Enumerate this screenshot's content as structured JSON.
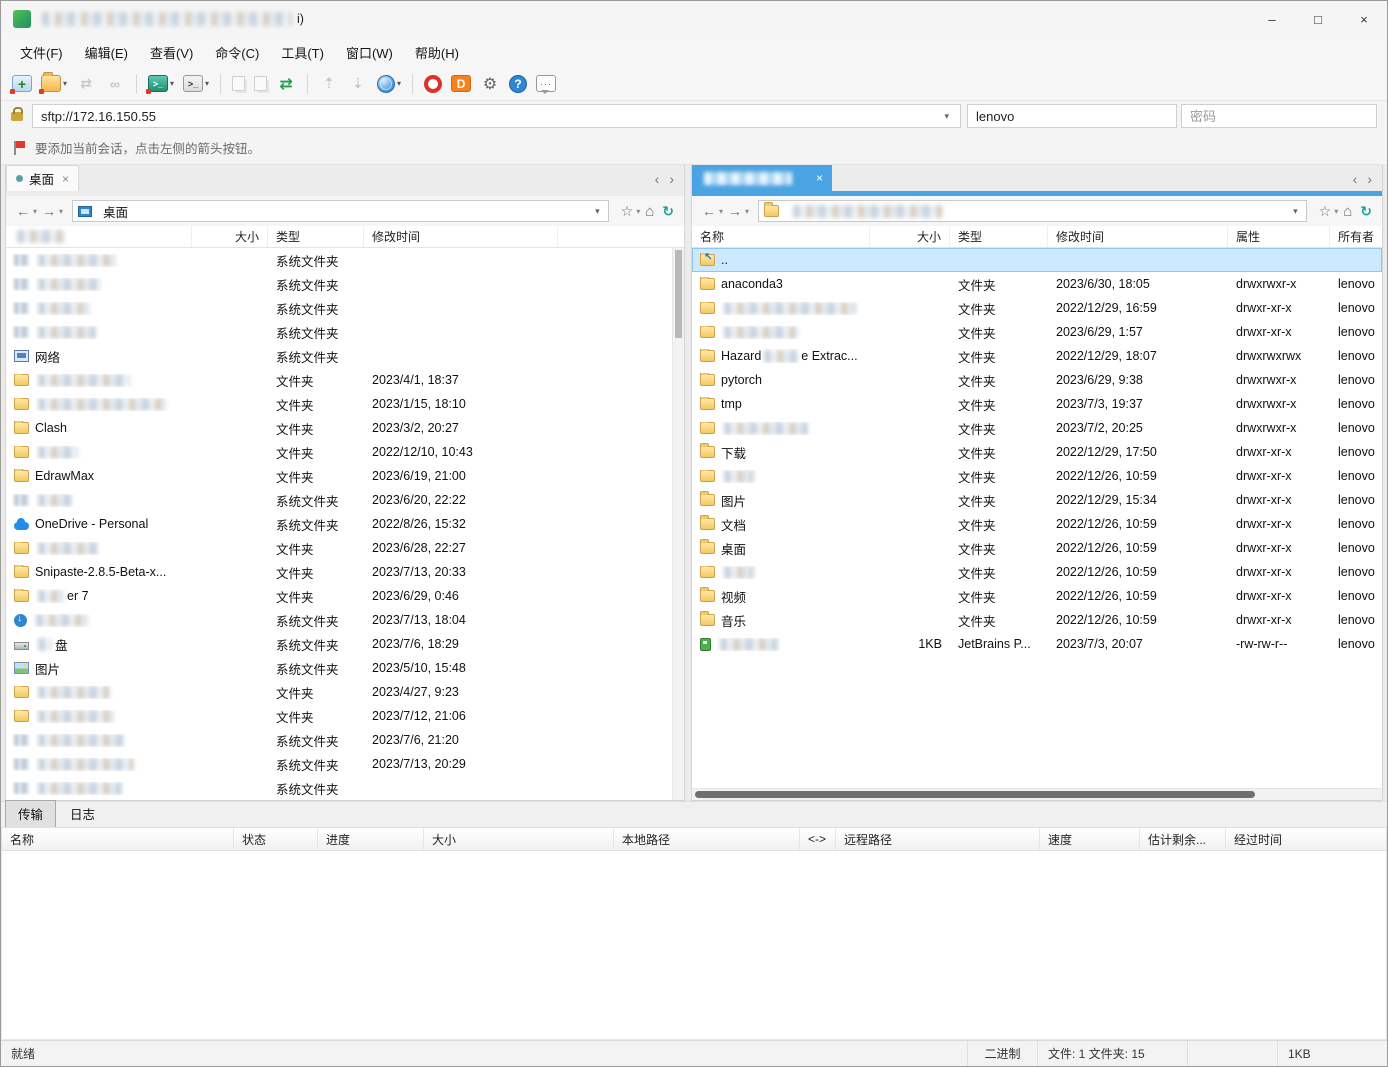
{
  "glyphs": {
    "caret": "▾",
    "back": "←",
    "forward": "→",
    "star": "☆",
    "home": "⌂",
    "refresh": "↻",
    "chev_left": "‹",
    "chev_right": "›"
  },
  "colors": {
    "accent_blue": "#4aa3e2",
    "selection": "#cde9ff",
    "badge_red": "#e03a2f"
  },
  "window": {
    "title_suffix": "i)",
    "minimize": "–",
    "maximize": "□",
    "close": "×"
  },
  "menu_bar": {
    "items": [
      "文件(F)",
      "编辑(E)",
      "查看(V)",
      "命令(C)",
      "工具(T)",
      "窗口(W)",
      "帮助(H)"
    ]
  },
  "toolbar": {
    "buttons": [
      {
        "icon": "new-session-icon",
        "badge": true
      },
      {
        "icon": "open-site-icon",
        "caret": true,
        "badge": true
      },
      {
        "icon": "sync-browsing-icon",
        "disabled": true
      },
      {
        "icon": "link-icon",
        "disabled": true
      },
      {
        "sep": true
      },
      {
        "icon": "terminal-icon",
        "caret": true,
        "badge": true
      },
      {
        "icon": "console-icon",
        "caret": true
      },
      {
        "sep": true
      },
      {
        "icon": "copy-files-icon",
        "disabled": true
      },
      {
        "icon": "move-files-icon",
        "disabled": true
      },
      {
        "icon": "swap-panels-icon"
      },
      {
        "sep": true
      },
      {
        "icon": "upload-queue-icon",
        "disabled": true
      },
      {
        "icon": "download-queue-icon",
        "disabled": true
      },
      {
        "icon": "globe-sites-icon",
        "caret": true
      },
      {
        "sep": true
      },
      {
        "icon": "opera-icon"
      },
      {
        "icon": "docs-icon"
      },
      {
        "icon": "settings-gear-icon"
      },
      {
        "icon": "help-icon"
      },
      {
        "icon": "feedback-icon"
      }
    ]
  },
  "address_bar": {
    "url": "sftp://172.16.150.55",
    "username": "lenovo",
    "password_placeholder": "密码"
  },
  "info_bar": {
    "text": "要添加当前会话，点击左侧的箭头按钮。"
  },
  "left_panel": {
    "tab": {
      "label": "桌面",
      "close": "×"
    },
    "nav": {
      "path": "桌面"
    },
    "columns": [
      {
        "redacted": true
      },
      {
        "label": "大小"
      },
      {
        "label": "类型"
      },
      {
        "label": "修改时间"
      }
    ],
    "rows": [
      {
        "icon": "blur",
        "name": [
          {
            "b": 78
          }
        ],
        "size": "",
        "type": "系统文件夹",
        "date": ""
      },
      {
        "icon": "blur",
        "name": [
          {
            "b": 64
          }
        ],
        "size": "",
        "type": "系统文件夹",
        "date": ""
      },
      {
        "icon": "blur",
        "name": [
          {
            "b": 52
          }
        ],
        "size": "",
        "type": "系统文件夹",
        "date": ""
      },
      {
        "icon": "blur",
        "name": [
          {
            "b": 58
          }
        ],
        "size": "",
        "type": "系统文件夹",
        "date": ""
      },
      {
        "icon": "network",
        "name": [
          {
            "t": "网络"
          }
        ],
        "size": "",
        "type": "系统文件夹",
        "date": ""
      },
      {
        "icon": "folder",
        "name": [
          {
            "b": 92
          }
        ],
        "size": "",
        "type": "文件夹",
        "date": "2023/4/1, 18:37"
      },
      {
        "icon": "folder",
        "name": [
          {
            "b": 128
          }
        ],
        "size": "",
        "type": "文件夹",
        "date": "2023/1/15, 18:10"
      },
      {
        "icon": "folder",
        "name": [
          {
            "t": "Clash"
          }
        ],
        "size": "",
        "type": "文件夹",
        "date": "2023/3/2, 20:27"
      },
      {
        "icon": "folder",
        "name": [
          {
            "b": 40
          }
        ],
        "size": "",
        "type": "文件夹",
        "date": "2022/12/10, 10:43"
      },
      {
        "icon": "folder",
        "name": [
          {
            "t": "EdrawMax"
          }
        ],
        "size": "",
        "type": "文件夹",
        "date": "2023/6/19, 21:00"
      },
      {
        "icon": "blur",
        "name": [
          {
            "b": 34
          }
        ],
        "size": "",
        "type": "系统文件夹",
        "date": "2023/6/20, 22:22"
      },
      {
        "icon": "cloud",
        "name": [
          {
            "t": "OneDrive - Personal"
          }
        ],
        "size": "",
        "type": "系统文件夹",
        "date": "2022/8/26, 15:32"
      },
      {
        "icon": "folder",
        "name": [
          {
            "b": 60
          }
        ],
        "size": "",
        "type": "文件夹",
        "date": "2023/6/28, 22:27"
      },
      {
        "icon": "folder",
        "name": [
          {
            "t": "Snipaste-2.8.5-Beta-x..."
          }
        ],
        "size": "",
        "type": "文件夹",
        "date": "2023/7/13, 20:33"
      },
      {
        "icon": "folder",
        "name": [
          {
            "b": 26
          },
          {
            "t": "er 7"
          }
        ],
        "size": "",
        "type": "文件夹",
        "date": "2023/6/29, 0:46"
      },
      {
        "icon": "download",
        "name": [
          {
            "b": 52
          }
        ],
        "size": "",
        "type": "系统文件夹",
        "date": "2023/7/13, 18:04"
      },
      {
        "icon": "drive",
        "name": [
          {
            "b": 14
          },
          {
            "t": "盘"
          }
        ],
        "size": "",
        "type": "系统文件夹",
        "date": "2023/7/6, 18:29"
      },
      {
        "icon": "picture",
        "name": [
          {
            "t": "图片"
          }
        ],
        "size": "",
        "type": "系统文件夹",
        "date": "2023/5/10, 15:48"
      },
      {
        "icon": "folder",
        "name": [
          {
            "b": 72
          }
        ],
        "size": "",
        "type": "文件夹",
        "date": "2023/4/27, 9:23"
      },
      {
        "icon": "folder",
        "name": [
          {
            "b": 76
          }
        ],
        "size": "",
        "type": "文件夹",
        "date": "2023/7/12, 21:06"
      },
      {
        "icon": "blur",
        "name": [
          {
            "b": 86
          }
        ],
        "size": "",
        "type": "系统文件夹",
        "date": "2023/7/6, 21:20"
      },
      {
        "icon": "blur",
        "name": [
          {
            "b": 96
          }
        ],
        "size": "",
        "type": "系统文件夹",
        "date": "2023/7/13, 20:29"
      },
      {
        "icon": "blur",
        "name": [
          {
            "b": 84
          }
        ],
        "size": "",
        "type": "系统文件夹",
        "date": ""
      }
    ]
  },
  "right_panel": {
    "tab": {
      "redacted": true,
      "close": "×"
    },
    "nav": {
      "path_redacted": true
    },
    "columns": [
      "名称",
      "大小",
      "类型",
      "修改时间",
      "属性",
      "所有者"
    ],
    "rows": [
      {
        "icon": "folder-up",
        "name": [
          {
            "t": ".."
          }
        ],
        "size": "",
        "type": "",
        "date": "",
        "attr": "",
        "owner": "",
        "selected": true
      },
      {
        "icon": "folder",
        "name": [
          {
            "t": "anaconda3"
          }
        ],
        "size": "",
        "type": "文件夹",
        "date": "2023/6/30, 18:05",
        "attr": "drwxrwxr-x",
        "owner": "lenovo"
      },
      {
        "icon": "folder",
        "name": [
          {
            "b": 132
          }
        ],
        "size": "",
        "type": "文件夹",
        "date": "2022/12/29, 16:59",
        "attr": "drwxr-xr-x",
        "owner": "lenovo"
      },
      {
        "icon": "folder",
        "name": [
          {
            "b": 74
          }
        ],
        "size": "",
        "type": "文件夹",
        "date": "2023/6/29, 1:57",
        "attr": "drwxr-xr-x",
        "owner": "lenovo"
      },
      {
        "icon": "folder",
        "name": [
          {
            "t": "Hazard"
          },
          {
            "b": 34
          },
          {
            "t": "e Extrac..."
          }
        ],
        "size": "",
        "type": "文件夹",
        "date": "2022/12/29, 18:07",
        "attr": "drwxrwxrwx",
        "owner": "lenovo"
      },
      {
        "icon": "folder",
        "name": [
          {
            "t": "pytorch"
          }
        ],
        "size": "",
        "type": "文件夹",
        "date": "2023/6/29, 9:38",
        "attr": "drwxrwxr-x",
        "owner": "lenovo"
      },
      {
        "icon": "folder",
        "name": [
          {
            "t": "tmp"
          }
        ],
        "size": "",
        "type": "文件夹",
        "date": "2023/7/3, 19:37",
        "attr": "drwxrwxr-x",
        "owner": "lenovo"
      },
      {
        "icon": "folder",
        "name": [
          {
            "b": 84
          }
        ],
        "size": "",
        "type": "文件夹",
        "date": "2023/7/2, 20:25",
        "attr": "drwxrwxr-x",
        "owner": "lenovo"
      },
      {
        "icon": "folder",
        "name": [
          {
            "t": "下载"
          }
        ],
        "size": "",
        "type": "文件夹",
        "date": "2022/12/29, 17:50",
        "attr": "drwxr-xr-x",
        "owner": "lenovo"
      },
      {
        "icon": "folder",
        "name": [
          {
            "b": 30
          }
        ],
        "size": "",
        "type": "文件夹",
        "date": "2022/12/26, 10:59",
        "attr": "drwxr-xr-x",
        "owner": "lenovo"
      },
      {
        "icon": "folder",
        "name": [
          {
            "t": "图片"
          }
        ],
        "size": "",
        "type": "文件夹",
        "date": "2022/12/29, 15:34",
        "attr": "drwxr-xr-x",
        "owner": "lenovo"
      },
      {
        "icon": "folder",
        "name": [
          {
            "t": "文档"
          }
        ],
        "size": "",
        "type": "文件夹",
        "date": "2022/12/26, 10:59",
        "attr": "drwxr-xr-x",
        "owner": "lenovo"
      },
      {
        "icon": "folder",
        "name": [
          {
            "t": "桌面"
          }
        ],
        "size": "",
        "type": "文件夹",
        "date": "2022/12/26, 10:59",
        "attr": "drwxr-xr-x",
        "owner": "lenovo"
      },
      {
        "icon": "folder",
        "name": [
          {
            "b": 30
          }
        ],
        "size": "",
        "type": "文件夹",
        "date": "2022/12/26, 10:59",
        "attr": "drwxr-xr-x",
        "owner": "lenovo"
      },
      {
        "icon": "folder",
        "name": [
          {
            "t": "视频"
          }
        ],
        "size": "",
        "type": "文件夹",
        "date": "2022/12/26, 10:59",
        "attr": "drwxr-xr-x",
        "owner": "lenovo"
      },
      {
        "icon": "folder",
        "name": [
          {
            "t": "音乐"
          }
        ],
        "size": "",
        "type": "文件夹",
        "date": "2022/12/26, 10:59",
        "attr": "drwxr-xr-x",
        "owner": "lenovo"
      },
      {
        "icon": "file-green",
        "name": [
          {
            "b": 58
          }
        ],
        "size": "1KB",
        "type": "JetBrains P...",
        "date": "2023/7/3, 20:07",
        "attr": "-rw-rw-r--",
        "owner": "lenovo"
      }
    ]
  },
  "transfer": {
    "tabs": [
      {
        "label": "传输",
        "selected": true
      },
      {
        "label": "日志",
        "selected": false
      }
    ],
    "columns": [
      "名称",
      "状态",
      "进度",
      "大小",
      "本地路径",
      "<->",
      "远程路径",
      "速度",
      "估计剩余...",
      "经过时间"
    ]
  },
  "status_bar": {
    "left": "就绪",
    "mode": "二进制",
    "counts": "文件: 1  文件夹: 15",
    "size": "1KB"
  }
}
